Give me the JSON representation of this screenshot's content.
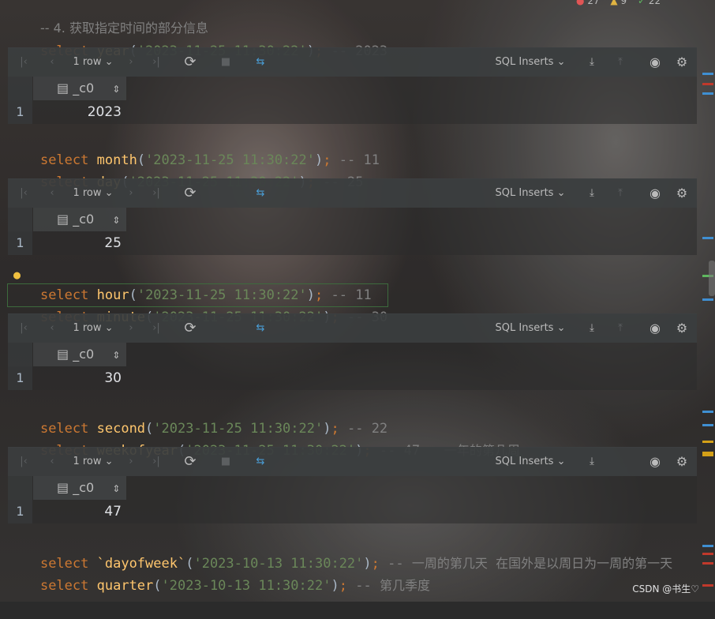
{
  "header_comment": "-- 4. 获取指定时间的部分信息",
  "inspection": {
    "errors": "27",
    "warnings": "9",
    "typos": "22"
  },
  "queries": {
    "q_year": {
      "kw": "select",
      "fn": "year",
      "arg": "'2023-11-25 11:30:22'",
      "cmt": "-- 2023"
    },
    "q_month": {
      "kw": "select",
      "fn": "month",
      "arg": "'2023-11-25 11:30:22'",
      "cmt": "-- 11"
    },
    "q_day": {
      "kw": "select",
      "fn": "day",
      "arg": "'2023-11-25 11:30:22'",
      "cmt": "-- 25"
    },
    "q_hour": {
      "kw": "select",
      "fn": "hour",
      "arg": "'2023-11-25 11:30:22'",
      "cmt": "-- 11"
    },
    "q_minute": {
      "kw": "select",
      "fn": "minute",
      "arg": "'2023-11-25 11:30:22'",
      "cmt": "-- 30"
    },
    "q_second": {
      "kw": "select",
      "fn": "second",
      "arg": "'2023-11-25 11:30:22'",
      "cmt": "-- 22"
    },
    "q_week": {
      "kw": "select",
      "fn": "weekofyear",
      "arg": "'2023-11-25 11:30:22'",
      "cmt": "-- 47",
      "cmt_cn": "一年的第几周"
    },
    "q_dow": {
      "kw": "select",
      "fn": "`dayofweek`",
      "arg": "'2023-10-13 11:30:22'",
      "cmt": "--",
      "cmt_cn": "一周的第几天  在国外是以周日为一周的第一天"
    },
    "q_quarter": {
      "kw": "select",
      "fn": "quarter",
      "arg": "'2023-10-13 11:30:22'",
      "cmt": "--",
      "cmt_cn": "第几季度"
    }
  },
  "toolbar": {
    "rows": "1 row",
    "export_format": "SQL Inserts",
    "icons": [
      "first-page-icon",
      "prev-page-icon",
      "next-page-icon",
      "last-page-icon",
      "reload-icon",
      "stop-icon",
      "compare-icon",
      "download-icon",
      "upload-icon",
      "view-icon",
      "settings-icon"
    ]
  },
  "results": [
    {
      "column": "_c0",
      "row_no": "1",
      "value": "2023"
    },
    {
      "column": "_c0",
      "row_no": "1",
      "value": "25"
    },
    {
      "column": "_c0",
      "row_no": "1",
      "value": "30"
    },
    {
      "column": "_c0",
      "row_no": "1",
      "value": "47"
    }
  ],
  "watermark": "CSDN @书生♡",
  "colors": {
    "keyword": "#cc7832",
    "function": "#ffc66d",
    "string": "#6a8759",
    "comment": "#808080",
    "text": "#a9b7c6"
  }
}
